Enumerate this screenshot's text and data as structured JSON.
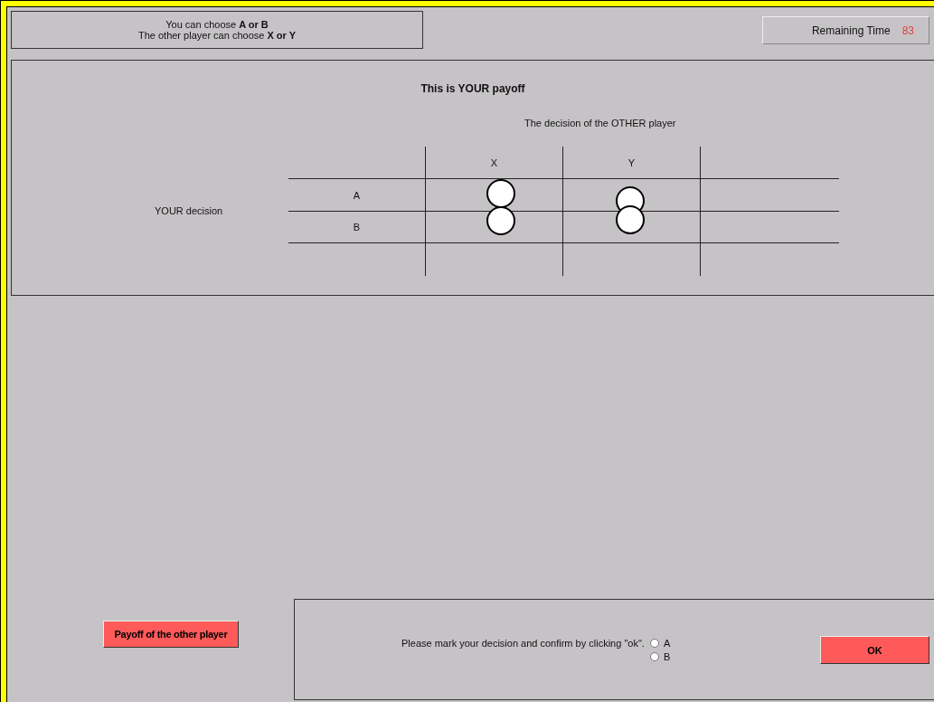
{
  "header": {
    "choices": "You can choose  **A or B**",
    "other_choices": "The other player can choose **X or Y**"
  },
  "timer": {
    "label": "Remaining Time",
    "value": "83"
  },
  "payoff_panel": {
    "title": "This is YOUR payoff",
    "column_heading": "The decision of the OTHER player",
    "row_heading": "YOUR decision",
    "columns": [
      "X",
      "Y"
    ],
    "rows": [
      "A",
      "B"
    ]
  },
  "other_payoff_button": "Payoff of the other player",
  "decision": {
    "prompt": "Please mark your decision and confirm by clicking \"ok\".",
    "options": [
      {
        "label": "A",
        "selected": false
      },
      {
        "label": "B",
        "selected": false
      }
    ],
    "ok_button": "OK"
  }
}
